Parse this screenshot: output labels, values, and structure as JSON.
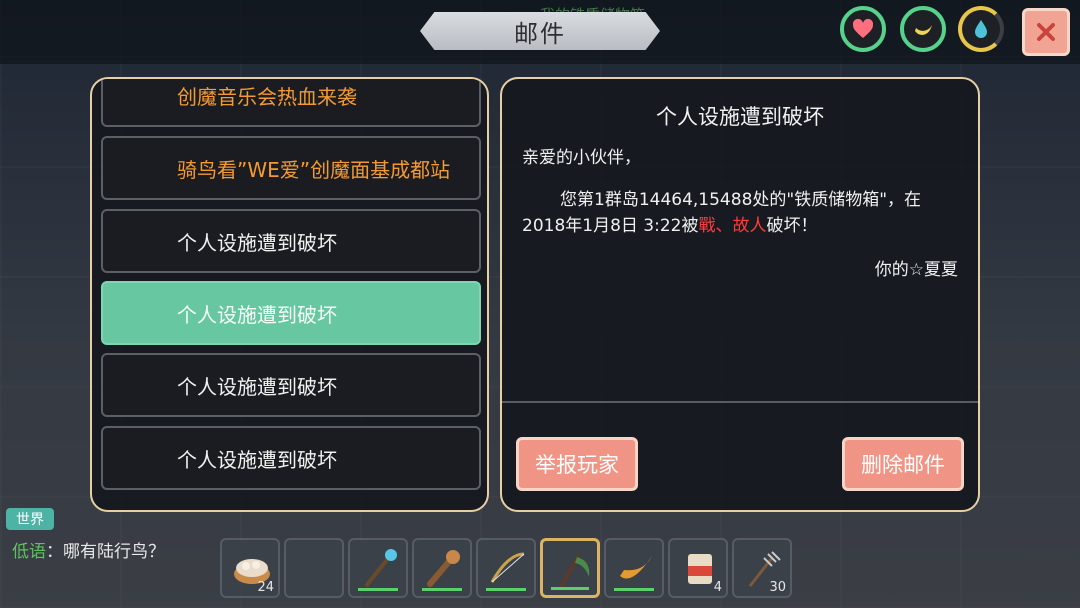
{
  "header": {
    "title": "邮件",
    "ghost_text": "我的铁质储物箱"
  },
  "status": {
    "hp_icon": "heart-icon",
    "food_icon": "banana-icon",
    "water_icon": "droplet-icon",
    "close_icon": "close-icon",
    "colors": {
      "good": "#56d28a",
      "water": "#e8c64a",
      "close_bg": "#f2a494"
    }
  },
  "mail_list": [
    {
      "title": "创魔音乐会热血来袭",
      "type": "event"
    },
    {
      "title": "骑鸟看”WE爱”创魔面基成都站",
      "type": "event"
    },
    {
      "title": "个人设施遭到破坏",
      "type": "system"
    },
    {
      "title": "个人设施遭到破坏",
      "type": "system",
      "selected": true
    },
    {
      "title": "个人设施遭到破坏",
      "type": "system"
    },
    {
      "title": "个人设施遭到破坏",
      "type": "system"
    }
  ],
  "detail": {
    "title": "个人设施遭到破坏",
    "greeting": "亲爱的小伙伴，",
    "body_prefix": "您第1群岛14464,15488处的\"铁质储物箱\"，在2018年1月8日 3:22被",
    "attacker": "戰、故人",
    "body_suffix": "破坏！",
    "signature": "你的☆夏夏",
    "report_button": "举报玩家",
    "delete_button": "删除邮件"
  },
  "chat": {
    "tab": "世界",
    "channel": "低语",
    "separator": "：",
    "message": "哪有陆行鸟？"
  },
  "hotbar": [
    {
      "icon": "dumpling-basket-icon",
      "count": "24"
    },
    {
      "icon": "empty-slot",
      "count": ""
    },
    {
      "icon": "crystal-staff-icon",
      "count": "",
      "durability": 0.8
    },
    {
      "icon": "bone-club-icon",
      "count": "",
      "durability": 0.8
    },
    {
      "icon": "bow-icon",
      "count": "",
      "durability": 0.8
    },
    {
      "icon": "scythe-icon",
      "count": "",
      "durability": 0.8,
      "selected": true
    },
    {
      "icon": "horn-icon",
      "count": "",
      "durability": 0.8
    },
    {
      "icon": "seed-bag-icon",
      "count": "4"
    },
    {
      "icon": "trident-icon",
      "count": "30"
    }
  ]
}
